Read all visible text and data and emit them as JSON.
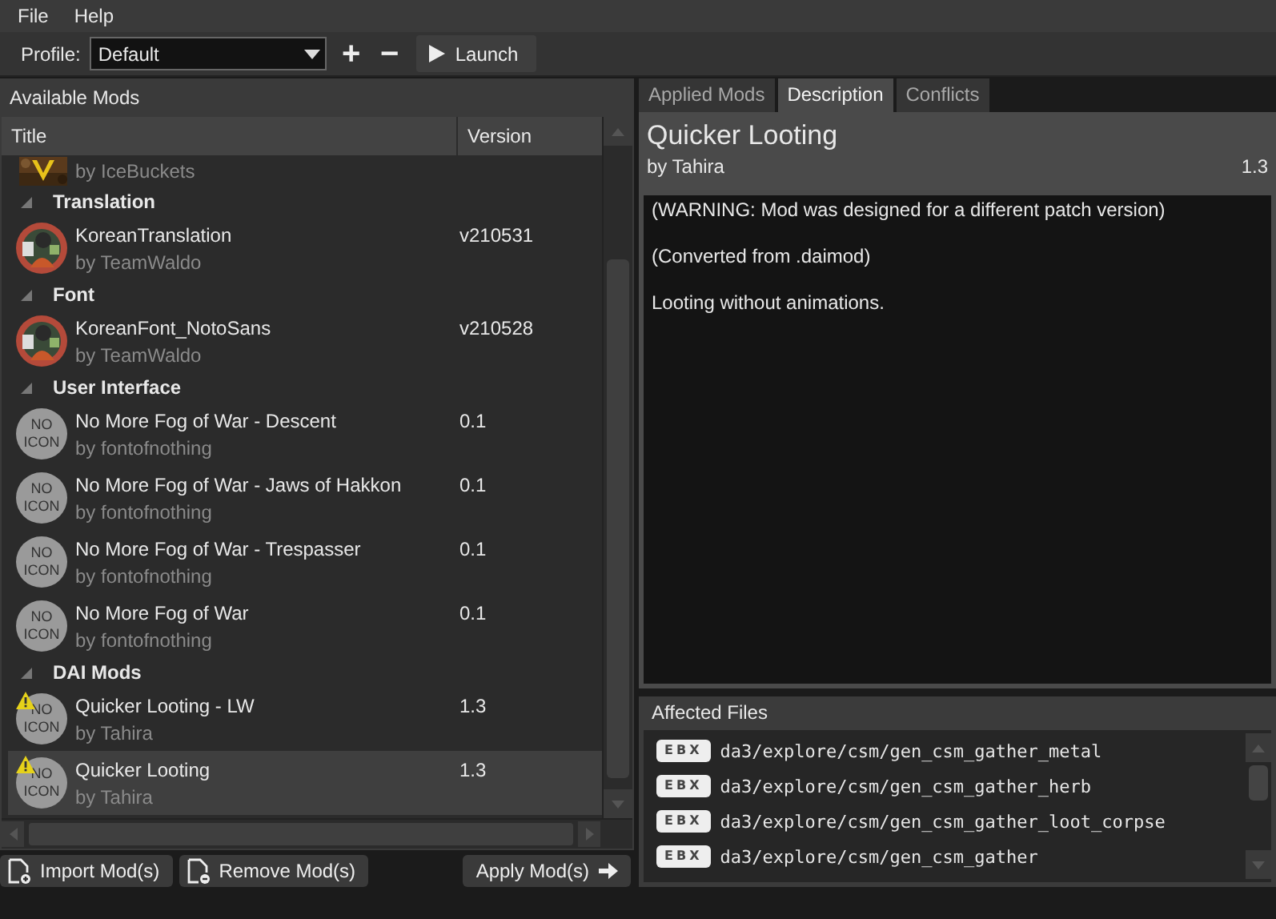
{
  "menu": [
    "File",
    "Help"
  ],
  "toolbar": {
    "profile_label": "Profile:",
    "profile_value": "Default",
    "add": "+",
    "remove": "−",
    "launch": "Launch"
  },
  "available_mods": {
    "title": "Available Mods",
    "columns": [
      "Title",
      "Version"
    ],
    "groups": [
      {
        "mods": [
          {
            "author": "by IceBuckets",
            "warning": false,
            "selected": false
          }
        ]
      },
      {
        "name": "Translation",
        "expanded": true,
        "mods": [
          {
            "title": "KoreanTranslation",
            "author": "by TeamWaldo",
            "version": "v210531",
            "icon": {
              "kind": "avatar"
            },
            "warning": false,
            "selected": false
          }
        ]
      },
      {
        "name": "Font",
        "expanded": true,
        "mods": [
          {
            "title": "KoreanFont_NotoSans",
            "author": "by TeamWaldo",
            "version": "v210528",
            "icon": {
              "kind": "avatar"
            },
            "warning": false,
            "selected": false
          }
        ]
      },
      {
        "name": "User Interface",
        "expanded": true,
        "mods": [
          {
            "title": "No More Fog of War - Descent",
            "author": "by fontofnothing",
            "version": "0.1",
            "icon": {
              "kind": "placeholder",
              "lines": [
                "NO",
                "ICON"
              ]
            },
            "warning": false,
            "selected": false
          },
          {
            "title": "No More Fog of War - Jaws of Hakkon",
            "author": "by fontofnothing",
            "version": "0.1",
            "icon": {
              "kind": "placeholder",
              "lines": [
                "NO",
                "ICON"
              ]
            },
            "warning": false,
            "selected": false
          },
          {
            "title": "No More Fog of War - Trespasser",
            "author": "by fontofnothing",
            "version": "0.1",
            "icon": {
              "kind": "placeholder",
              "lines": [
                "NO",
                "ICON"
              ]
            },
            "warning": false,
            "selected": false
          },
          {
            "title": "No More Fog of War",
            "author": "by fontofnothing",
            "version": "0.1",
            "icon": {
              "kind": "placeholder",
              "lines": [
                "NO",
                "ICON"
              ]
            },
            "warning": false,
            "selected": false
          }
        ]
      },
      {
        "name": "DAI Mods",
        "expanded": true,
        "mods": [
          {
            "title": "Quicker Looting - LW",
            "author": "by Tahira",
            "version": "1.3",
            "icon": {
              "kind": "placeholder",
              "lines": [
                "NO",
                "ICON"
              ]
            },
            "warning": true,
            "selected": false
          },
          {
            "title": "Quicker Looting",
            "author": "by Tahira",
            "version": "1.3",
            "icon": {
              "kind": "placeholder",
              "lines": [
                "NO",
                "ICON"
              ]
            },
            "warning": true,
            "selected": true
          }
        ]
      }
    ]
  },
  "buttons": {
    "import": "Import Mod(s)",
    "remove": "Remove Mod(s)",
    "apply": "Apply Mod(s)"
  },
  "tabs": [
    {
      "label": "Applied Mods",
      "selected": false
    },
    {
      "label": "Description",
      "selected": true
    },
    {
      "label": "Conflicts",
      "selected": false
    }
  ],
  "description": {
    "title": "Quicker Looting",
    "author": "by Tahira",
    "version": "1.3",
    "paragraphs": [
      "(WARNING: Mod was designed for a different patch version)",
      "(Converted from .daimod)",
      "Looting without animations."
    ]
  },
  "affected_files": {
    "title": "Affected Files",
    "files": [
      {
        "type": "EBX",
        "path": "da3/explore/csm/gen_csm_gather_metal"
      },
      {
        "type": "EBX",
        "path": "da3/explore/csm/gen_csm_gather_herb"
      },
      {
        "type": "EBX",
        "path": "da3/explore/csm/gen_csm_gather_loot_corpse"
      },
      {
        "type": "EBX",
        "path": "da3/explore/csm/gen_csm_gather"
      }
    ]
  }
}
